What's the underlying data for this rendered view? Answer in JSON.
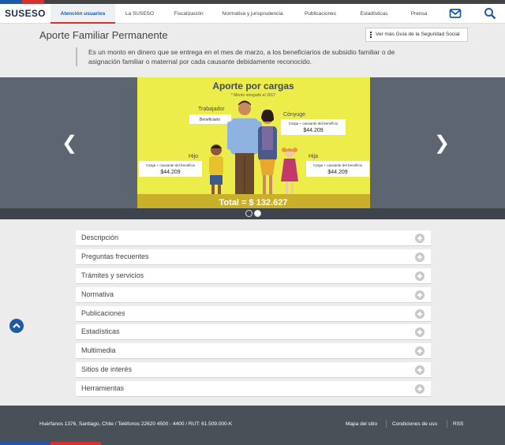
{
  "header": {
    "logo": "SUSESO",
    "nav": [
      {
        "label": "Atención usuarios",
        "active": true
      },
      {
        "label": "La SUSESO",
        "active": false
      },
      {
        "label": "Fiscalización",
        "active": false
      },
      {
        "label": "Normativa y jurisprudencia",
        "active": false
      },
      {
        "label": "Publicaciones",
        "active": false
      },
      {
        "label": "Estadísticas",
        "active": false
      },
      {
        "label": "Prensa",
        "active": false
      }
    ],
    "icons": {
      "mail": "mail-icon",
      "search": "search-icon"
    }
  },
  "page": {
    "title": "Aporte Familiar Permanente",
    "guide_button": "Ver más Guía de la Seguridad Social",
    "description": "Es un monto en dinero que se entrega en el mes de marzo, a los beneficiarios de subsidio familiar o de asignación familiar o maternal por cada causante debidamente reconocido."
  },
  "slide": {
    "title": "Aporte por cargas",
    "subtitle": "* Monto otorgado el 2017",
    "trabajador": "Trabajador",
    "beneficiario": "Beneficiario",
    "conyuge": "Cónyuge",
    "hijo": "Hijo",
    "hija": "Hija",
    "carga": "Carga + causante del beneficio",
    "amount": "$44.209",
    "total": "Total = $ 132.627"
  },
  "accordion": [
    "Descripción",
    "Preguntas frecuentes",
    "Trámites y servicios",
    "Normativa",
    "Publicaciones",
    "Estadísticas",
    "Multimedia",
    "Sitios de interés",
    "Herramientas"
  ],
  "footer": {
    "address": "Huérfanos 1376, Santiago, Chile / Teléfonos 22620 4500 - 4400 / RUT: 61.509.000-K",
    "links": [
      "Mapa del sitio",
      "Condiciones de uso",
      "RSS"
    ]
  },
  "colors": {
    "brand_blue": "#1f5aa8",
    "brand_red": "#d6312d",
    "slide_yellow": "#ecec4a",
    "footer": "#4a5058"
  }
}
